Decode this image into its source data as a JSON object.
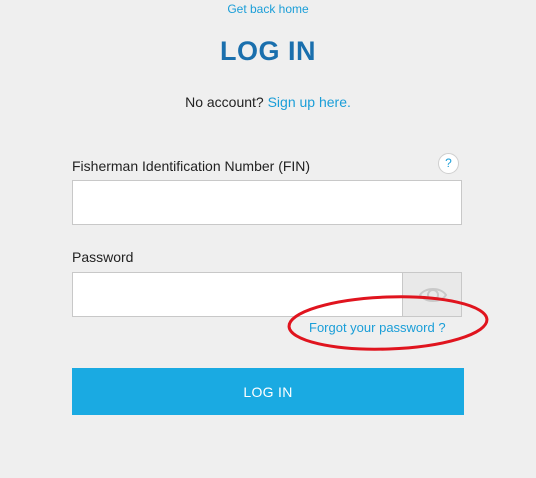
{
  "nav": {
    "home_link": "Get back home"
  },
  "page": {
    "title": "LOG IN",
    "no_account_text": "No account?",
    "signup_link": "Sign up here."
  },
  "form": {
    "fin_label": "Fisherman Identification Number (FIN)",
    "fin_value": "",
    "help_icon": "question-icon",
    "help_text": "?",
    "password_label": "Password",
    "password_value": "",
    "eye_icon": "eye-icon",
    "forgot_link": "Forgot your password ?",
    "login_button": "LOG IN"
  },
  "annotation": {
    "color": "#e0141e",
    "shape": "ellipse"
  },
  "colors": {
    "accent": "#1a9ed8",
    "title": "#1a6fad",
    "button": "#1aaae2",
    "background": "#efefef"
  }
}
